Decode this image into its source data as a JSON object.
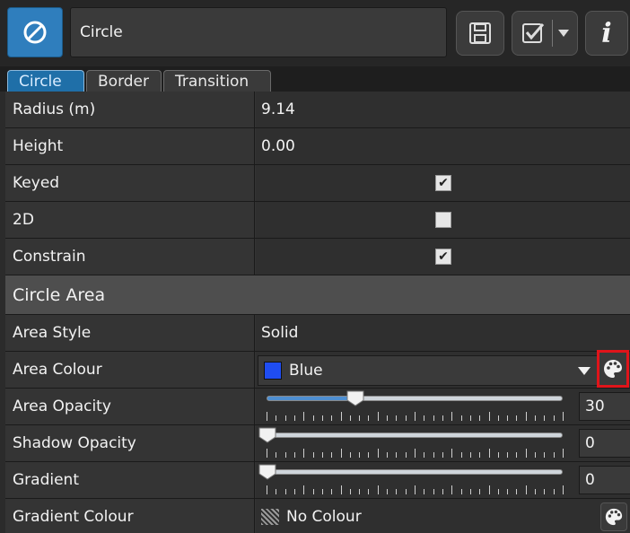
{
  "header": {
    "icon": "no-entry-circle-icon",
    "name_value": "Circle",
    "buttons": [
      "save-icon",
      "check-icon",
      "info-icon"
    ],
    "info_label": "i"
  },
  "tabs": [
    {
      "label": "Circle",
      "active": true
    },
    {
      "label": "Border",
      "active": false
    },
    {
      "label": "Transition",
      "active": false
    }
  ],
  "properties": {
    "radius": {
      "label": "Radius (m)",
      "value": "9.14"
    },
    "height": {
      "label": "Height",
      "value": "0.00"
    },
    "keyed": {
      "label": "Keyed",
      "checked": true,
      "mark": "✔"
    },
    "two_d": {
      "label": "2D",
      "checked": false,
      "mark": ""
    },
    "constrain": {
      "label": "Constrain",
      "checked": true,
      "mark": "✔"
    }
  },
  "section_title": "Circle Area",
  "area": {
    "style": {
      "label": "Area Style",
      "value": "Solid"
    },
    "colour": {
      "label": "Area Colour",
      "value": "Blue",
      "swatch": "#1f4df2"
    },
    "opacity": {
      "label": "Area Opacity",
      "value": "30",
      "level": 0.3
    },
    "shadow_opacity": {
      "label": "Shadow Opacity",
      "value": "0",
      "level": 0
    },
    "gradient": {
      "label": "Gradient",
      "value": "0",
      "level": 0
    },
    "gradient_colour": {
      "label": "Gradient Colour",
      "value": "No Colour"
    }
  },
  "colors": {
    "accent": "#1f6fa8",
    "highlight_border": "#e0141a"
  }
}
